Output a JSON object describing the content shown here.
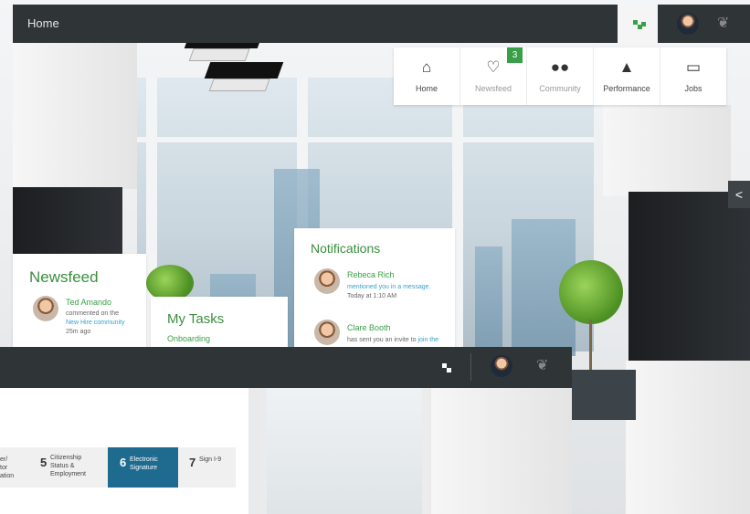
{
  "header": {
    "title": "Home"
  },
  "nav": {
    "tiles": [
      {
        "label": "Home",
        "icon": "home-icon"
      },
      {
        "label": "Newsfeed",
        "icon": "chat-icon",
        "badge": "3"
      },
      {
        "label": "Community",
        "icon": "community-icon"
      },
      {
        "label": "Performance",
        "icon": "chart-icon"
      },
      {
        "label": "Jobs",
        "icon": "laptop-icon"
      }
    ]
  },
  "newsfeed": {
    "title": "Newsfeed",
    "item": {
      "name": "Ted Amando",
      "line1": "commented on the",
      "link": "New Hire community",
      "time": "25m ago"
    }
  },
  "tasks": {
    "title": "My Tasks",
    "item": "Onboarding"
  },
  "notifications": {
    "title": "Notifications",
    "items": [
      {
        "name": "Rebeca Rich",
        "line1": "mentioned you in a message.",
        "time": "Today at 1:10 AM"
      },
      {
        "name": "Clare Booth",
        "line1": "has sent you an invite to",
        "link": "join the"
      }
    ]
  },
  "steps": [
    {
      "num": "",
      "text": "er/\ntor\nation"
    },
    {
      "num": "5",
      "text": "Citizenship\nStatus &\nEmployment"
    },
    {
      "num": "6",
      "text": "Electronic\nSignature",
      "active": true
    },
    {
      "num": "7",
      "text": "Sign I-9"
    }
  ],
  "colors": {
    "accent": "#3aa047",
    "bar": "#2f3436",
    "step_active": "#1e6b8f"
  }
}
